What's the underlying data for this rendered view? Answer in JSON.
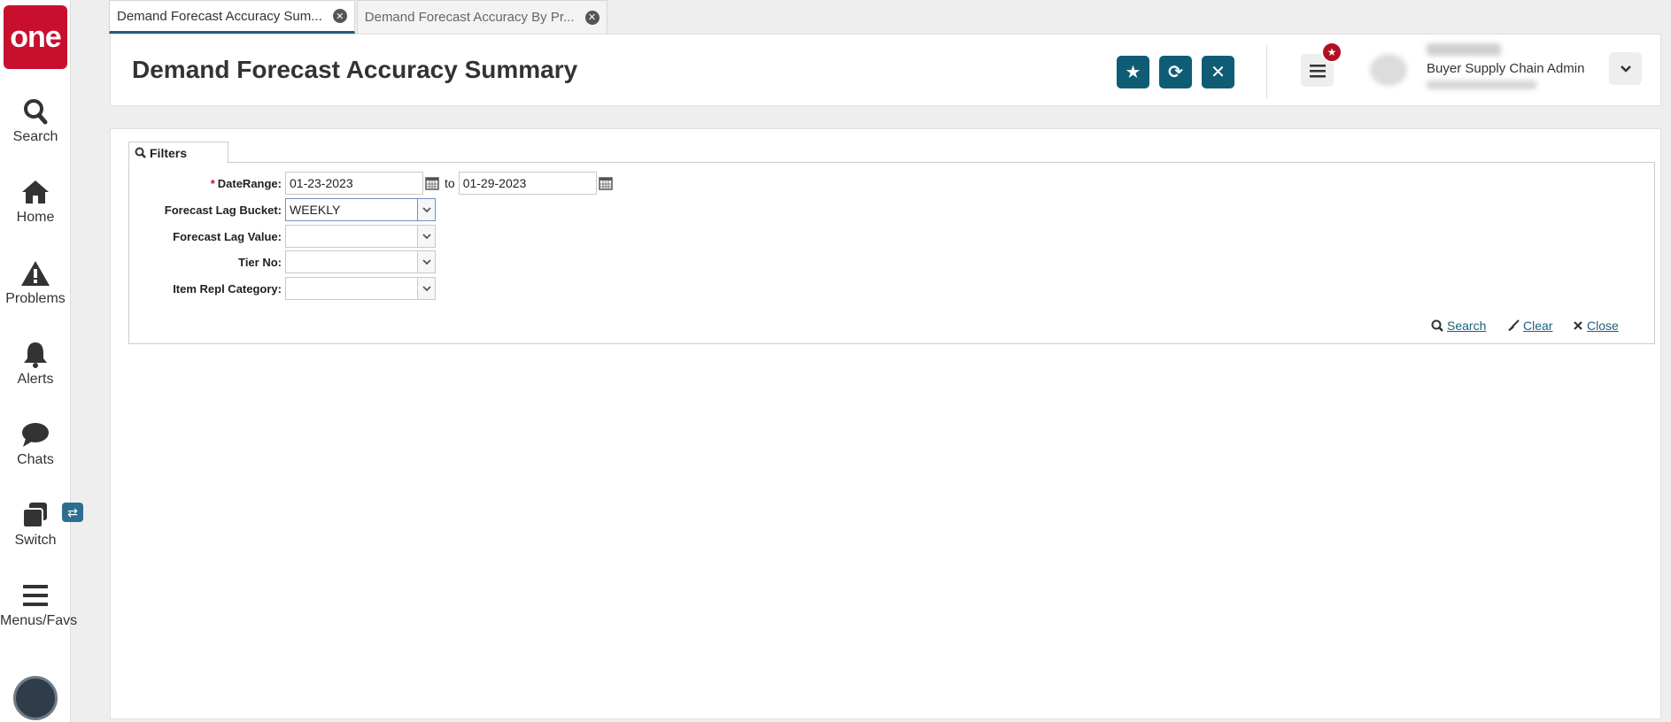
{
  "brand": {
    "logo_text": "one",
    "logo_color": "#c8102e"
  },
  "sidebar": {
    "items": [
      {
        "label": "Search",
        "icon": "search-icon"
      },
      {
        "label": "Home",
        "icon": "home-icon"
      },
      {
        "label": "Problems",
        "icon": "warning-icon"
      },
      {
        "label": "Alerts",
        "icon": "bell-icon"
      },
      {
        "label": "Chats",
        "icon": "chat-icon"
      },
      {
        "label": "Switch",
        "icon": "switch-icon"
      },
      {
        "label": "Menus/Favs",
        "icon": "hamburger-icon"
      }
    ]
  },
  "tabs": [
    {
      "label": "Demand Forecast Accuracy Sum...",
      "active": true
    },
    {
      "label": "Demand Forecast Accuracy By Pr...",
      "active": false
    }
  ],
  "header": {
    "title": "Demand Forecast Accuracy Summary",
    "user_role": "Buyer Supply Chain Admin",
    "accent": "#0e5d74"
  },
  "filters": {
    "tab_label": "Filters",
    "date_range": {
      "label": "DateRange:",
      "required_mark": "*",
      "from": "01-23-2023",
      "to_word": "to",
      "to": "01-29-2023"
    },
    "forecast_lag_bucket": {
      "label": "Forecast Lag Bucket:",
      "value": "WEEKLY"
    },
    "forecast_lag_value": {
      "label": "Forecast Lag Value:",
      "value": ""
    },
    "tier_no": {
      "label": "Tier No:",
      "value": ""
    },
    "item_repl_category": {
      "label": "Item Repl Category:",
      "value": ""
    },
    "actions": {
      "search": "Search",
      "clear": "Clear",
      "close": "Close"
    }
  }
}
